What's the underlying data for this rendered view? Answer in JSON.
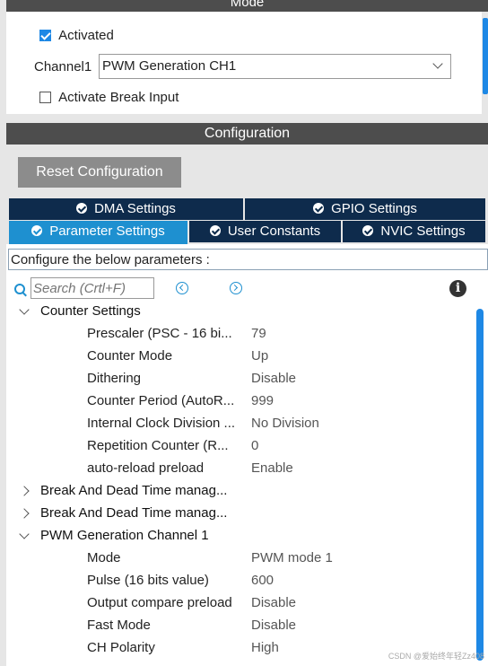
{
  "mode_section": {
    "title": "Mode",
    "activated_label": "Activated",
    "activated_checked": true,
    "channel_label": "Channel1",
    "channel_value": "PWM Generation CH1",
    "break_label": "Activate Break Input",
    "break_checked": false
  },
  "config_section": {
    "title": "Configuration",
    "reset_label": "Reset Configuration",
    "tabs_row1": [
      {
        "label": "DMA Settings"
      },
      {
        "label": "GPIO Settings"
      }
    ],
    "tabs_row2": [
      {
        "label": "Parameter Settings",
        "active": true
      },
      {
        "label": "User Constants"
      },
      {
        "label": "NVIC Settings"
      }
    ],
    "hint": "Configure the below parameters :",
    "search_placeholder": "Search (Crtl+F)"
  },
  "tree": {
    "counter_settings": {
      "label": "Counter Settings",
      "rows": [
        {
          "key": "Prescaler (PSC - 16 bi...",
          "value": "79"
        },
        {
          "key": "Counter Mode",
          "value": "Up"
        },
        {
          "key": "Dithering",
          "value": "Disable"
        },
        {
          "key": "Counter Period (AutoR...",
          "value": "999"
        },
        {
          "key": "Internal Clock Division ...",
          "value": "No Division"
        },
        {
          "key": "Repetition Counter (R...",
          "value": "0"
        },
        {
          "key": "auto-reload preload",
          "value": "Enable"
        }
      ]
    },
    "break1": "Break And Dead Time manag...",
    "break2": "Break And Dead Time manag...",
    "pwm_channel1": {
      "label": "PWM Generation Channel 1",
      "rows": [
        {
          "key": "Mode",
          "value": "PWM mode 1"
        },
        {
          "key": "Pulse (16 bits value)",
          "value": "600"
        },
        {
          "key": "Output compare preload",
          "value": "Disable"
        },
        {
          "key": "Fast Mode",
          "value": "Disable"
        },
        {
          "key": "CH Polarity",
          "value": "High"
        }
      ]
    }
  },
  "watermark": "CSDN @爱始终年轻Zz408",
  "colors": {
    "accent": "#1e90d0",
    "tab_dark": "#0e2b4c",
    "header": "#4d4d4d"
  }
}
